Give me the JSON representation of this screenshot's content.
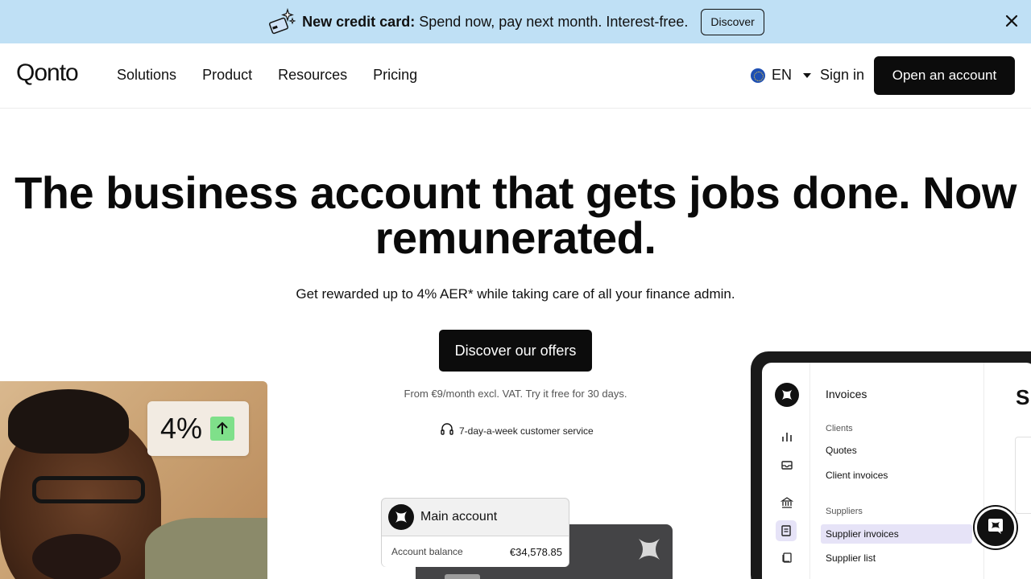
{
  "banner": {
    "bold": "New credit card:",
    "text": " Spend now, pay next month. Interest-free.",
    "button": "Discover",
    "icon": "credit-card-sparkle-icon",
    "background": "#bfe0f5"
  },
  "nav": {
    "logo": "Qonto",
    "links": [
      "Solutions",
      "Product",
      "Resources",
      "Pricing"
    ],
    "language": "EN",
    "sign_in": "Sign in",
    "open_account": "Open an account"
  },
  "hero": {
    "title": "The business account that gets jobs done. Now remunerated.",
    "subtitle": "Get rewarded up to 4% AER* while taking care of all your finance admin.",
    "cta": "Discover our offers",
    "price_note": "From €9/month excl. VAT. Try it free for 30 days.",
    "service": "7-day-a-week customer service"
  },
  "visuals": {
    "rate": "4%",
    "account_title": "Main account",
    "balance_label": "Account balance",
    "balance_value": "€34,578.85"
  },
  "app": {
    "panel_title": "Invoices",
    "clients_header": "Clients",
    "clients_items": [
      "Quotes",
      "Client invoices"
    ],
    "suppliers_header": "Suppliers",
    "suppliers_items": [
      "Supplier invoices",
      "Supplier list"
    ],
    "right_heading": "S"
  }
}
